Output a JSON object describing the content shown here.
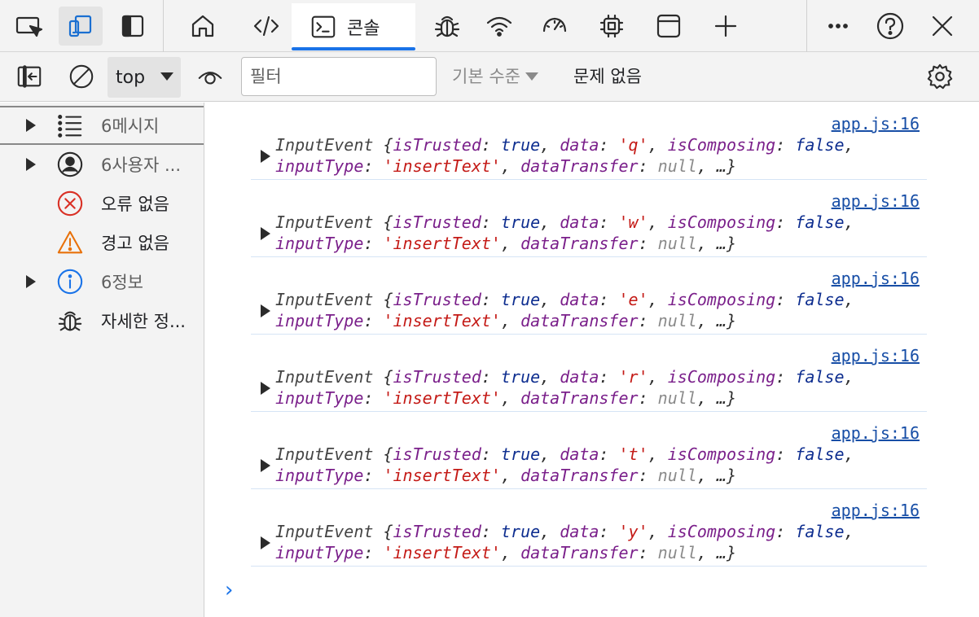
{
  "toolbar": {
    "tabs": [
      {
        "name": "inspect",
        "icon": "inspect-icon"
      },
      {
        "name": "device-emulation",
        "icon": "device-icon"
      },
      {
        "name": "dock",
        "icon": "dock-side-icon"
      },
      {
        "name": "welcome",
        "icon": "home-icon"
      },
      {
        "name": "elements",
        "icon": "code-icon"
      },
      {
        "name": "console",
        "icon": "console-icon",
        "label": "콘솔",
        "active": true
      },
      {
        "name": "sources",
        "icon": "bug-icon"
      },
      {
        "name": "network",
        "icon": "wifi-icon"
      },
      {
        "name": "performance",
        "icon": "gauge-icon"
      },
      {
        "name": "memory",
        "icon": "chip-icon"
      },
      {
        "name": "application",
        "icon": "window-icon"
      },
      {
        "name": "more-tools",
        "icon": "plus-icon"
      }
    ],
    "more_icon": "ellipsis-icon",
    "help_icon": "help-icon",
    "close_icon": "close-icon"
  },
  "console_toolbar": {
    "context": "top",
    "filter_placeholder": "필터",
    "level": "기본 수준",
    "issues": "문제 없음"
  },
  "sidebar": {
    "items": [
      {
        "label": "6메시지",
        "icon": "list-icon",
        "expandable": true,
        "selected": true
      },
      {
        "label": "6사용자 ...",
        "icon": "user-icon",
        "expandable": true
      },
      {
        "label": "오류 없음",
        "icon": "error-icon",
        "expandable": false
      },
      {
        "label": "경고 없음",
        "icon": "warning-icon",
        "expandable": false
      },
      {
        "label": "6정보",
        "icon": "info-icon",
        "expandable": true
      },
      {
        "label": "자세한 정...",
        "icon": "bug-icon",
        "expandable": false
      }
    ]
  },
  "messages": [
    {
      "source": "app.js:16",
      "object_type": "InputEvent",
      "isTrusted": "true",
      "data": "'q'",
      "isComposing": "false",
      "inputType": "'insertText'",
      "dataTransfer": "null"
    },
    {
      "source": "app.js:16",
      "object_type": "InputEvent",
      "isTrusted": "true",
      "data": "'w'",
      "isComposing": "false",
      "inputType": "'insertText'",
      "dataTransfer": "null"
    },
    {
      "source": "app.js:16",
      "object_type": "InputEvent",
      "isTrusted": "true",
      "data": "'e'",
      "isComposing": "false",
      "inputType": "'insertText'",
      "dataTransfer": "null"
    },
    {
      "source": "app.js:16",
      "object_type": "InputEvent",
      "isTrusted": "true",
      "data": "'r'",
      "isComposing": "false",
      "inputType": "'insertText'",
      "dataTransfer": "null"
    },
    {
      "source": "app.js:16",
      "object_type": "InputEvent",
      "isTrusted": "true",
      "data": "'t'",
      "isComposing": "false",
      "inputType": "'insertText'",
      "dataTransfer": "null"
    },
    {
      "source": "app.js:16",
      "object_type": "InputEvent",
      "isTrusted": "true",
      "data": "'y'",
      "isComposing": "false",
      "inputType": "'insertText'",
      "dataTransfer": "null"
    }
  ],
  "prompt_symbol": "›",
  "colors": {
    "accent": "#1a73e8",
    "key": "#7a1f8a",
    "boolean": "#0d2d8f",
    "string": "#c41a16",
    "null": "#8a8a8a",
    "error": "#d93025",
    "warning": "#e8710a",
    "info": "#1a73e8"
  }
}
